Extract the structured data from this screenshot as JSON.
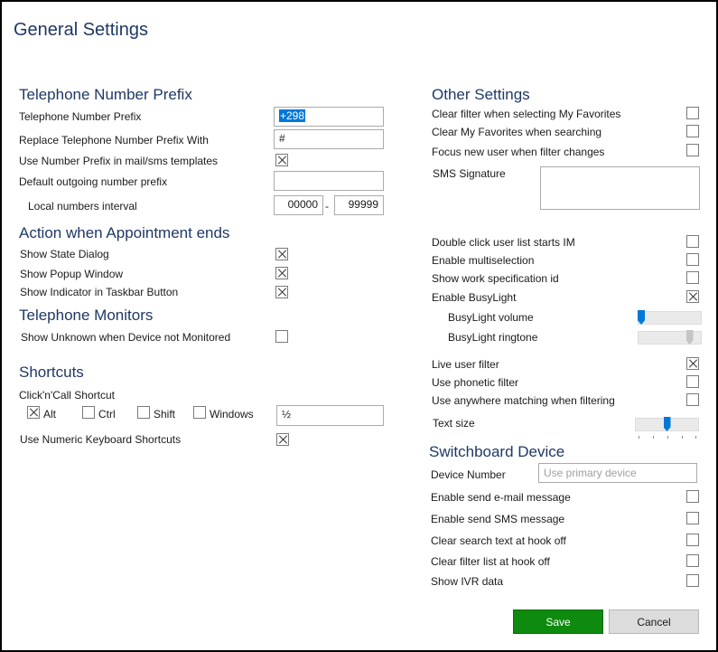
{
  "page_title": "General Settings",
  "telephone_prefix": {
    "title": "Telephone Number Prefix",
    "prefix_label": "Telephone Number Prefix",
    "prefix_value": "+298",
    "replace_label": "Replace Telephone Number Prefix With",
    "replace_value": "#",
    "use_in_templates_label": "Use Number Prefix in mail/sms templates",
    "use_in_templates_checked": true,
    "default_outgoing_label": "Default outgoing number prefix",
    "default_outgoing_value": "",
    "local_interval_label": "Local numbers interval",
    "local_from": "00000",
    "local_dash": "-",
    "local_to": "99999"
  },
  "appointment": {
    "title": "Action when Appointment ends",
    "items": [
      {
        "label": "Show State Dialog",
        "checked": true
      },
      {
        "label": "Show Popup Window",
        "checked": true
      },
      {
        "label": "Show Indicator in Taskbar Button",
        "checked": true
      }
    ]
  },
  "monitors": {
    "title": "Telephone Monitors",
    "items": [
      {
        "label": "Show Unknown when Device not Monitored",
        "checked": false
      }
    ]
  },
  "shortcuts": {
    "title": "Shortcuts",
    "clickncall_label": "Click'n'Call Shortcut",
    "modifiers": [
      {
        "label": "Alt",
        "checked": true
      },
      {
        "label": "Ctrl",
        "checked": false
      },
      {
        "label": "Shift",
        "checked": false
      },
      {
        "label": "Windows",
        "checked": false
      }
    ],
    "key_value": "½",
    "numeric_label": "Use Numeric Keyboard Shortcuts",
    "numeric_checked": true
  },
  "other": {
    "title": "Other Settings",
    "items": [
      {
        "label": "Clear filter when selecting My Favorites",
        "checked": false
      },
      {
        "label": "Clear My Favorites when searching",
        "checked": false
      },
      {
        "label": "Focus new user when filter changes",
        "checked": false
      }
    ],
    "sms_signature_label": "SMS Signature",
    "sms_signature_value": "",
    "items2": [
      {
        "label": "Double click user list starts IM",
        "checked": false
      },
      {
        "label": "Enable  multiselection",
        "checked": false
      },
      {
        "label": "Show work specification id",
        "checked": false
      },
      {
        "label": "Enable BusyLight",
        "checked": true
      }
    ],
    "busylight_volume_label": "BusyLight volume",
    "busylight_volume_level": 0.0,
    "busylight_ringtone_label": "BusyLight ringtone",
    "busylight_ringtone_level": 0.85,
    "items3": [
      {
        "label": "Live user filter",
        "checked": true
      },
      {
        "label": "Use phonetic filter",
        "checked": false
      },
      {
        "label": "Use anywhere matching when filtering",
        "checked": false
      }
    ],
    "text_size_label": "Text size",
    "text_size_level": 0.5
  },
  "switchboard": {
    "title": "Switchboard Device",
    "device_number_label": "Device Number",
    "device_number_placeholder": "Use primary device",
    "items": [
      {
        "label": "Enable send e-mail message",
        "checked": false
      },
      {
        "label": "Enable send SMS message",
        "checked": false
      },
      {
        "label": "Clear search text at hook off",
        "checked": false
      },
      {
        "label": "Clear filter list at hook off",
        "checked": false
      },
      {
        "label": "Show IVR data",
        "checked": false
      }
    ]
  },
  "buttons": {
    "save": "Save",
    "cancel": "Cancel"
  },
  "colors": {
    "heading": "#1f3864",
    "save_button": "#0e8a0e",
    "cancel_button": "#dcdcdc",
    "slider_thumb": "#0078d7",
    "selection": "#0078d7"
  }
}
